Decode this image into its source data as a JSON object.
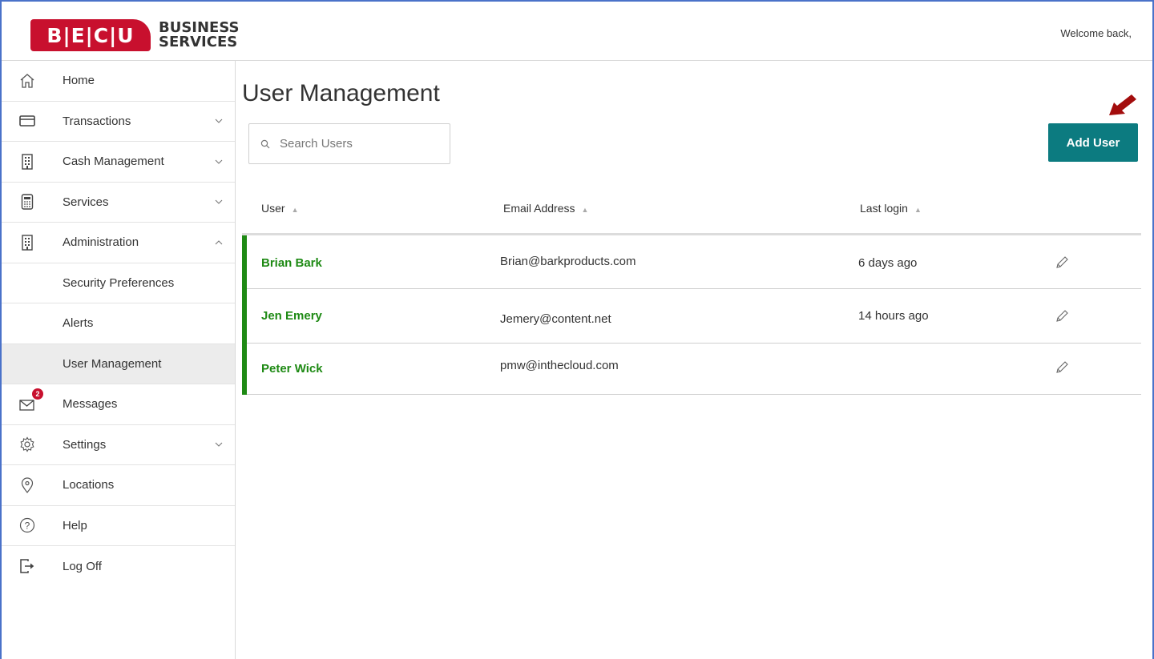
{
  "header": {
    "logo_letters": "B|E|C|U",
    "logo_line1": "BUSINESS",
    "logo_line2": "SERVICES",
    "welcome": "Welcome back,"
  },
  "sidebar": {
    "items": [
      {
        "label": "Home",
        "icon": "home-icon"
      },
      {
        "label": "Transactions",
        "icon": "card-icon",
        "chevron": "down"
      },
      {
        "label": "Cash Management",
        "icon": "building-icon",
        "chevron": "down"
      },
      {
        "label": "Services",
        "icon": "calculator-icon",
        "chevron": "down"
      },
      {
        "label": "Administration",
        "icon": "building-icon",
        "chevron": "up"
      },
      {
        "label": "Security Preferences"
      },
      {
        "label": "Alerts"
      },
      {
        "label": "User Management",
        "active": true
      },
      {
        "label": "Messages",
        "icon": "envelope-icon",
        "badge": "2"
      },
      {
        "label": "Settings",
        "icon": "gear-icon",
        "chevron": "down"
      },
      {
        "label": "Locations",
        "icon": "location-pin-icon"
      },
      {
        "label": "Help",
        "icon": "help-icon"
      },
      {
        "label": "Log Off",
        "icon": "logout-icon"
      }
    ]
  },
  "main": {
    "title": "User Management",
    "search_placeholder": "Search Users",
    "add_user_label": "Add User",
    "columns": [
      "User",
      "Email Address",
      "Last login"
    ],
    "rows": [
      {
        "name": "Brian Bark",
        "email": "Brian@barkproducts.com",
        "last_login": "6 days ago"
      },
      {
        "name": "Jen Emery",
        "email": "Jemery@content.net",
        "last_login": "14 hours ago"
      },
      {
        "name": "Peter Wick",
        "email": "pmw@inthecloud.com",
        "last_login": ""
      }
    ]
  },
  "colors": {
    "brand_red": "#c8102e",
    "accent_teal": "#0c7b80",
    "user_green": "#1e8a14",
    "annotation_arrow": "#a30d0d"
  }
}
